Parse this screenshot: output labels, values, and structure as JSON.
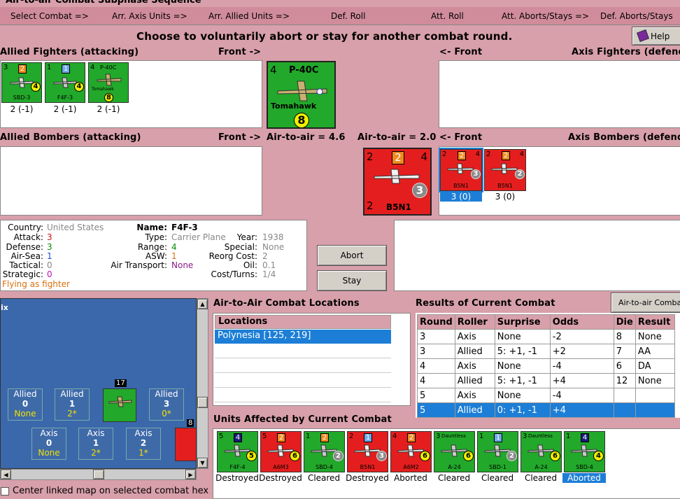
{
  "title": "Air-to-air Combat Subphase Sequence",
  "phases": [
    "Select Combat =>",
    "Arr. Axis Units =>",
    "Arr. Allied Units =>",
    "Def. Roll",
    "Att. Roll",
    "Att. Aborts/Stays =>",
    "Def. Aborts/Stays"
  ],
  "help_label": "Help",
  "instruction": "Choose to voluntarily abort or stay for another combat round.",
  "sections": {
    "allied_fighters": "Allied Fighters (attacking)",
    "front_right": "Front ->",
    "front_left": "<- Front",
    "axis_fighters": "Axis Fighters (defending)",
    "allied_bombers": "Allied Bombers (attacking)",
    "axis_bombers": "Axis Bombers (defending)",
    "air_to_air_allied": "Air-to-air = 4.6",
    "air_to_air_axis": "Air-to-air = 2.0"
  },
  "allied_fighters": [
    {
      "top_left": "3",
      "box": "2",
      "name": "SBD-3",
      "val": "4",
      "caption": "2 (-1)"
    },
    {
      "top_left": "1",
      "box": "1",
      "name": "F4F-3",
      "val": "4",
      "caption": "2 (-1)"
    },
    {
      "top_left": "4",
      "box": "P-40C",
      "name": "Tomahawk",
      "val": "8",
      "caption": "2 (-1)"
    }
  ],
  "big_allied": {
    "top_left": "4",
    "top": "P-40C",
    "name": "Tomahawk",
    "val": "8"
  },
  "big_axis": {
    "tl": "2",
    "box": "2",
    "tr": "4",
    "bl": "2",
    "name": "B5N1",
    "val": "3"
  },
  "axis_bombers": [
    {
      "tl": "2",
      "box": "2",
      "tr": "4",
      "name": "B5N1",
      "val": "3",
      "caption": "3 (0)"
    },
    {
      "tl": "2",
      "box": "2",
      "tr": "4",
      "name": "B5N1",
      "val": "2",
      "caption": "3 (0)"
    }
  ],
  "unit_info": {
    "country_label": "Country:",
    "country": "United States",
    "attack_label": "Attack:",
    "attack": "3",
    "defense_label": "Defense:",
    "defense": "3",
    "airsea_label": "Air-Sea:",
    "airsea": "1",
    "tactical_label": "Tactical:",
    "tactical": "0",
    "strategic_label": "Strategic:",
    "strategic": "0",
    "flying": "Flying as fighter",
    "name_label": "Name:",
    "name": "F4F-3",
    "type_label": "Type:",
    "type": "Carrier Plane",
    "range_label": "Range:",
    "range": "4",
    "asw_label": "ASW:",
    "asw": "1",
    "airtransport_label": "Air Transport:",
    "airtransport": "None",
    "year_label": "Year:",
    "year": "1938",
    "special_label": "Special:",
    "special": "None",
    "reorg_label": "Reorg Cost:",
    "reorg": "2",
    "oil_label": "Oil:",
    "oil": "0.1",
    "costturns_label": "Cost/Turns:",
    "costturns": "1/4"
  },
  "buttons": {
    "abort": "Abort",
    "stay": "Stay",
    "results_tab": "Air-to-air Combat Chart"
  },
  "map": {
    "label": "ix",
    "stack_count": "17",
    "stack_count2": "8",
    "allied": [
      {
        "label": "Allied",
        "n": "0",
        "s": "None"
      },
      {
        "label": "Allied",
        "n": "1",
        "s": "2*"
      },
      {
        "label": "Allied",
        "n": "3",
        "s": "0*"
      }
    ],
    "axis": [
      {
        "label": "Axis",
        "n": "0",
        "s": "None"
      },
      {
        "label": "Axis",
        "n": "1",
        "s": "2*"
      },
      {
        "label": "Axis",
        "n": "2",
        "s": "1*"
      }
    ]
  },
  "center_checkbox": "Center linked map on selected combat hex",
  "locations": {
    "title": "Air-to-Air Combat Locations",
    "header": "Locations",
    "items": [
      "Polynesia [125, 219]"
    ]
  },
  "results": {
    "title": "Results of Current Combat",
    "columns": [
      "Round",
      "Roller",
      "Surprise",
      "Odds",
      "Die",
      "Result"
    ],
    "rows": [
      [
        "3",
        "Axis",
        "None",
        "-2",
        "8",
        "None"
      ],
      [
        "3",
        "Allied",
        "5: +1, -1",
        "+2",
        "7",
        "AA"
      ],
      [
        "4",
        "Axis",
        "None",
        "-4",
        "6",
        "DA"
      ],
      [
        "4",
        "Allied",
        "5: +1, -1",
        "+4",
        "12",
        "None"
      ],
      [
        "5",
        "Axis",
        "None",
        "-4",
        "",
        ""
      ],
      [
        "5",
        "Allied",
        "0: +1, -1",
        "+4",
        "",
        ""
      ]
    ]
  },
  "affected": {
    "title": "Units Affected by Current Combat",
    "units": [
      {
        "color": "g",
        "tl": "5",
        "box": "4",
        "boxc": "n",
        "name": "F4F-4",
        "val": "5",
        "vc": "y",
        "caption": "Destroyed"
      },
      {
        "color": "r",
        "tl": "5",
        "box": "2",
        "boxc": "o",
        "name": "A6M3",
        "val": "6",
        "vc": "y",
        "caption": "Destroyed"
      },
      {
        "color": "g",
        "tl": "1",
        "box": "2",
        "boxc": "o",
        "name": "SBD-4",
        "val": "2",
        "vc": "g",
        "caption": "Cleared"
      },
      {
        "color": "r",
        "tl": "2",
        "box": "1",
        "boxc": "b",
        "name": "B5N1",
        "val": "3",
        "vc": "g",
        "caption": "Destroyed"
      },
      {
        "color": "r",
        "tl": "4",
        "box": "2",
        "boxc": "o",
        "name": "A6M2",
        "val": "6",
        "vc": "y",
        "caption": "Aborted"
      },
      {
        "color": "g",
        "tl": "3",
        "box": "Dauntless",
        "boxc": "t",
        "name": "A-24",
        "val": "6",
        "vc": "y",
        "caption": "Cleared"
      },
      {
        "color": "g",
        "tl": "1",
        "box": "1",
        "boxc": "b",
        "name": "SBD-1",
        "val": "2",
        "vc": "g",
        "caption": "Cleared"
      },
      {
        "color": "g",
        "tl": "3",
        "box": "Dauntless",
        "boxc": "t",
        "name": "A-24",
        "val": "6",
        "vc": "y",
        "caption": "Cleared"
      },
      {
        "color": "g",
        "tl": "1",
        "box": "4",
        "boxc": "n",
        "name": "SBD-4",
        "val": "4",
        "vc": "y",
        "caption": "Aborted"
      }
    ]
  }
}
